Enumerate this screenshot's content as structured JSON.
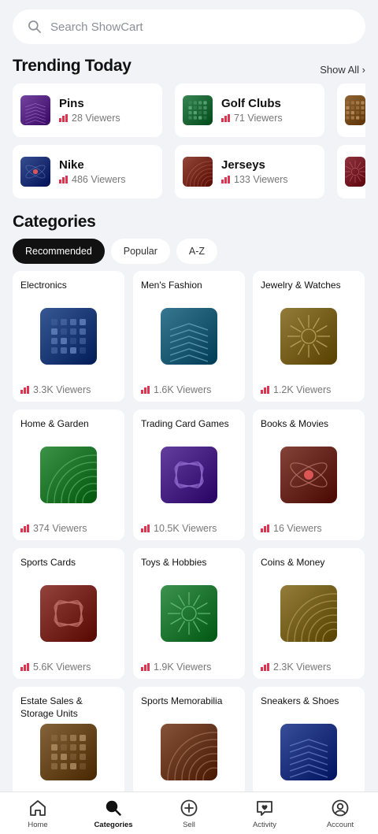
{
  "search": {
    "placeholder": "Search ShowCart"
  },
  "trending": {
    "title": "Trending Today",
    "show_all": "Show All ›",
    "items": [
      {
        "name": "Pins",
        "viewers": "28 Viewers",
        "thumb": "chevrons",
        "color": "#5a2a86"
      },
      {
        "name": "Golf Clubs",
        "viewers": "71 Viewers",
        "thumb": "grid",
        "color": "#1f6b3a"
      },
      {
        "name": "Nike",
        "viewers": "486 Viewers",
        "thumb": "atom",
        "color": "#1e3477"
      },
      {
        "name": "Jerseys",
        "viewers": "133 Viewers",
        "thumb": "arcs",
        "color": "#7a2e22"
      }
    ]
  },
  "categories": {
    "title": "Categories",
    "tabs": [
      {
        "label": "Recommended",
        "active": true
      },
      {
        "label": "Popular",
        "active": false
      },
      {
        "label": "A-Z",
        "active": false
      }
    ],
    "items": [
      {
        "name": "Electronics",
        "viewers": "3.3K Viewers",
        "thumb": "grid",
        "color": "#1e3f7a"
      },
      {
        "name": "Men's Fashion",
        "viewers": "1.6K Viewers",
        "thumb": "chevrons",
        "color": "#1f5e78"
      },
      {
        "name": "Jewelry & Watches",
        "viewers": "1.2K Viewers",
        "thumb": "sunburst",
        "color": "#7a6220"
      },
      {
        "name": "Home & Garden",
        "viewers": "374 Viewers",
        "thumb": "arcs",
        "color": "#237a2e"
      },
      {
        "name": "Trading Card Games",
        "viewers": "10.5K Viewers",
        "thumb": "cards",
        "color": "#4a2586"
      },
      {
        "name": "Books & Movies",
        "viewers": "16 Viewers",
        "thumb": "atom",
        "color": "#6b2a20"
      },
      {
        "name": "Sports Cards",
        "viewers": "5.6K Viewers",
        "thumb": "cards",
        "color": "#7a2a22"
      },
      {
        "name": "Toys & Hobbies",
        "viewers": "1.9K Viewers",
        "thumb": "sunburst",
        "color": "#237a34"
      },
      {
        "name": "Coins & Money",
        "viewers": "2.3K Viewers",
        "thumb": "arcs",
        "color": "#7a6420"
      },
      {
        "name": "Estate Sales & Storage Units",
        "viewers": "",
        "thumb": "grid",
        "color": "#6b4a20"
      },
      {
        "name": "Sports Memorabilia",
        "viewers": "",
        "thumb": "arcs",
        "color": "#6b3a20"
      },
      {
        "name": "Sneakers & Shoes",
        "viewers": "",
        "thumb": "chevrons",
        "color": "#1e3580"
      }
    ]
  },
  "nav": [
    {
      "label": "Home",
      "icon": "home-icon",
      "active": false
    },
    {
      "label": "Categories",
      "icon": "search-icon",
      "active": true
    },
    {
      "label": "Sell",
      "icon": "plus-circle-icon",
      "active": false
    },
    {
      "label": "Activity",
      "icon": "chat-heart-icon",
      "active": false
    },
    {
      "label": "Account",
      "icon": "account-icon",
      "active": false
    }
  ],
  "colors": {
    "accent_bars": "#e0334f",
    "chip_active_bg": "#111111"
  }
}
